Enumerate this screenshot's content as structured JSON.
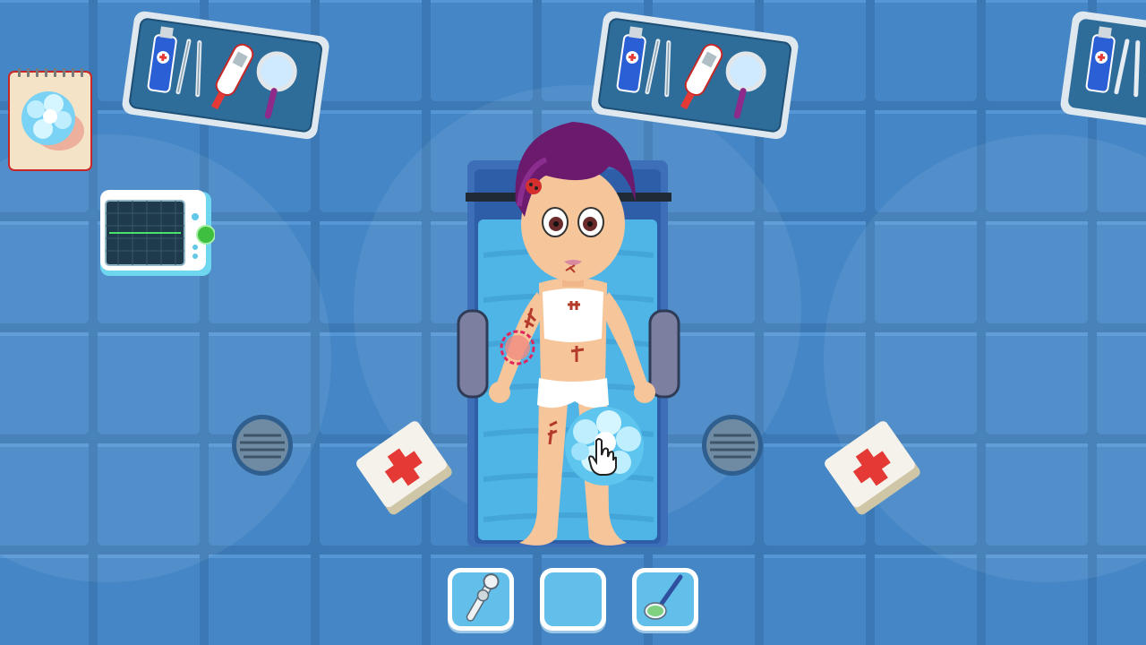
{
  "scene": {
    "name": "operating-room",
    "colors": {
      "background": "#3f7fbf",
      "tile_line": "#3a75b0",
      "tile_face": "#4a8ccb",
      "bed": "#3c72c5",
      "sheet": "#4fb4e6",
      "hair": "#6b1a6d",
      "skin": "#f7c59a",
      "wound": "#b43b2a",
      "target_ring": "#e0245e"
    }
  },
  "top_trays": [
    {
      "tools": [
        "ointment-tube-icon",
        "tweezers-icon",
        "thermometer-icon",
        "magnifier-icon"
      ]
    },
    {
      "tools": [
        "ointment-tube-icon",
        "tweezers-icon",
        "thermometer-icon",
        "magnifier-icon"
      ]
    },
    {
      "tools": [
        "ointment-tube-icon",
        "tweezers-icon",
        "thermometer-icon",
        "magnifier-icon"
      ]
    }
  ],
  "task_card": {
    "icon": "ice-pack-icon"
  },
  "monitor": {
    "icon": "heart-monitor-icon"
  },
  "patient": {
    "state": "injured",
    "active_tool": "ice-pack-icon"
  },
  "tool_bar": {
    "slots": [
      {
        "icon": "scope-tool-icon"
      },
      {
        "icon": "empty-slot"
      },
      {
        "icon": "ointment-spoon-icon"
      }
    ]
  }
}
